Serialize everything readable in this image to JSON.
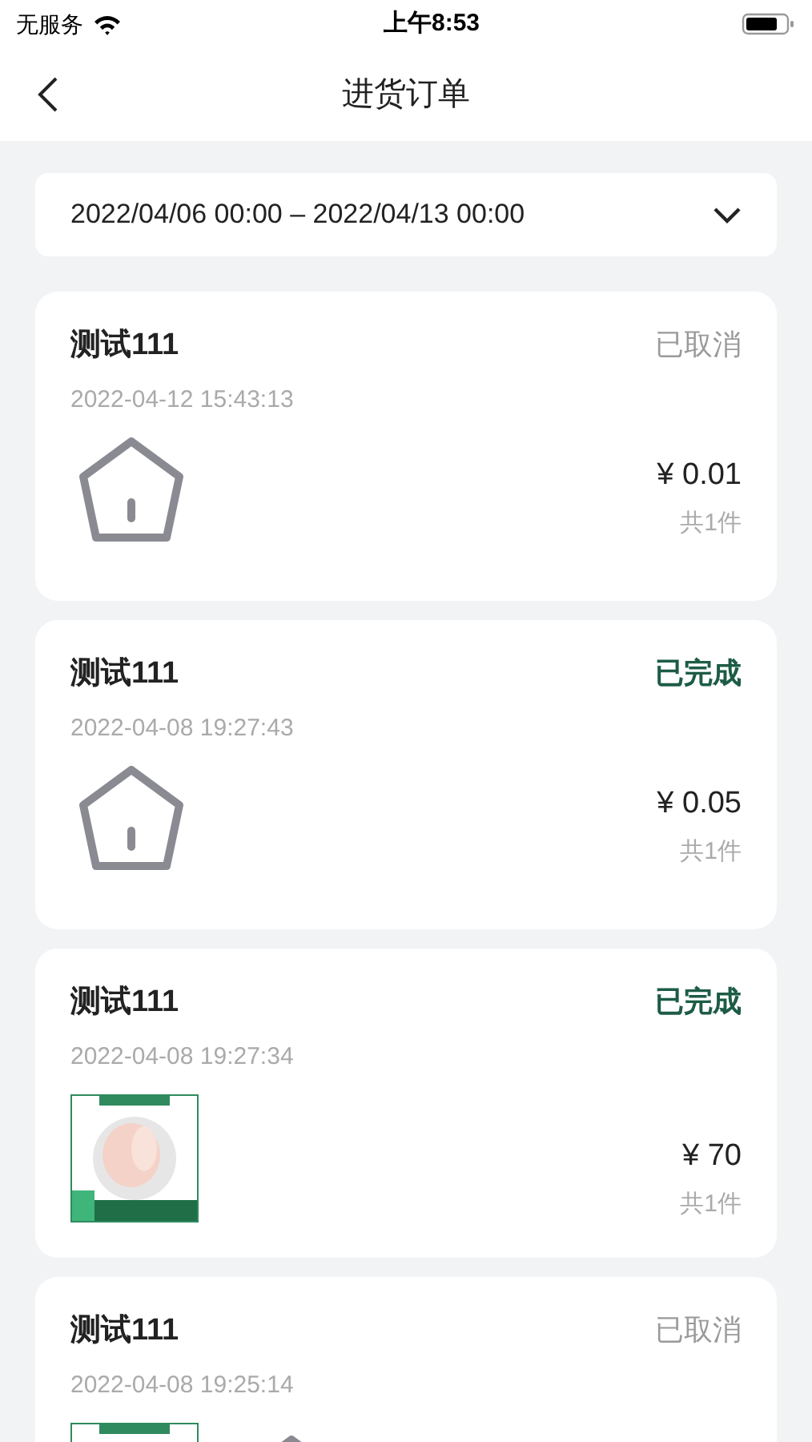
{
  "status_bar": {
    "carrier": "无服务",
    "time": "上午8:53"
  },
  "nav": {
    "title": "进货订单"
  },
  "date_range": "2022/04/06 00:00 – 2022/04/13 00:00",
  "orders": [
    {
      "name": "测试111",
      "status": "已取消",
      "kind": "cancelled",
      "time": "2022-04-12 15:43:13",
      "images": [
        {
          "kind": "placeholder"
        }
      ],
      "price": "¥ 0.01",
      "count": "共1件"
    },
    {
      "name": "测试111",
      "status": "已完成",
      "kind": "completed",
      "time": "2022-04-08 19:27:43",
      "images": [
        {
          "kind": "placeholder"
        }
      ],
      "price": "¥ 0.05",
      "count": "共1件"
    },
    {
      "name": "测试111",
      "status": "已完成",
      "kind": "completed",
      "time": "2022-04-08 19:27:34",
      "images": [
        {
          "kind": "picture"
        }
      ],
      "price": "¥ 70",
      "count": "共1件"
    },
    {
      "name": "测试111",
      "status": "已取消",
      "kind": "cancelled",
      "time": "2022-04-08 19:25:14",
      "images": [
        {
          "kind": "picture"
        },
        {
          "kind": "placeholder"
        }
      ]
    }
  ]
}
